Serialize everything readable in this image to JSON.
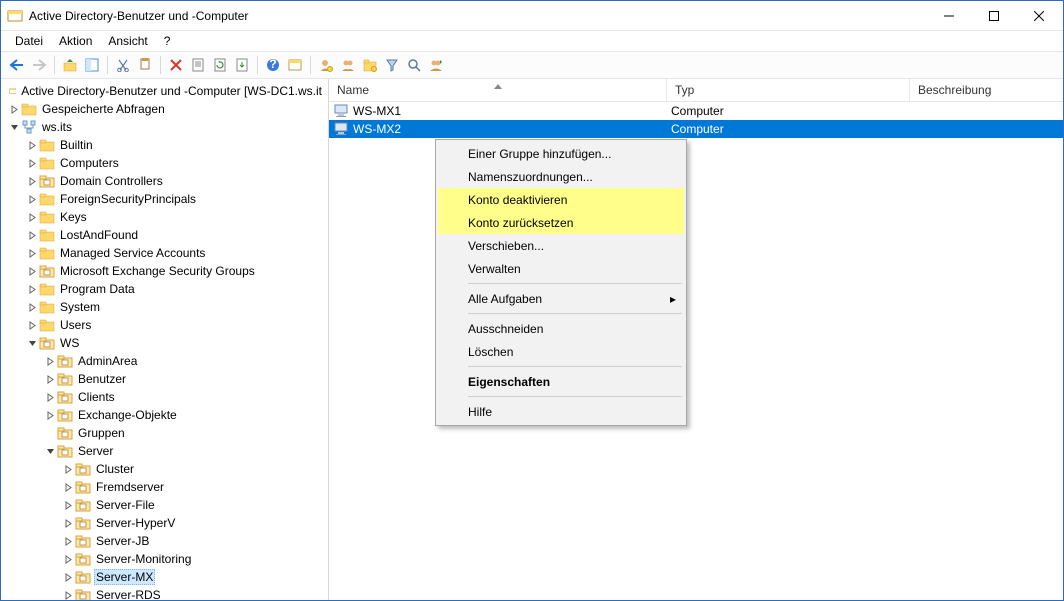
{
  "window": {
    "title": "Active Directory-Benutzer und -Computer"
  },
  "menu": {
    "file": "Datei",
    "action": "Aktion",
    "view": "Ansicht",
    "help": "?"
  },
  "tree": {
    "root": "Active Directory-Benutzer und -Computer [WS-DC1.ws.it",
    "saved_queries": "Gespeicherte Abfragen",
    "domain": "ws.its",
    "builtin": "Builtin",
    "computers": "Computers",
    "domain_controllers": "Domain Controllers",
    "fsp": "ForeignSecurityPrincipals",
    "keys": "Keys",
    "laf": "LostAndFound",
    "msa": "Managed Service Accounts",
    "mesg": "Microsoft Exchange Security Groups",
    "pdata": "Program Data",
    "system": "System",
    "users": "Users",
    "ws": "WS",
    "adminarea": "AdminArea",
    "benutzer": "Benutzer",
    "clients": "Clients",
    "exobj": "Exchange-Objekte",
    "gruppen": "Gruppen",
    "server": "Server",
    "cluster": "Cluster",
    "fremd": "Fremdserver",
    "srvfile": "Server-File",
    "srvhv": "Server-HyperV",
    "srvjb": "Server-JB",
    "srvmon": "Server-Monitoring",
    "srvmx": "Server-MX",
    "srvrds": "Server-RDS"
  },
  "columns": {
    "name": "Name",
    "typ": "Typ",
    "besch": "Beschreibung"
  },
  "rows": [
    {
      "name": "WS-MX1",
      "typ": "Computer",
      "selected": false
    },
    {
      "name": "WS-MX2",
      "typ": "Computer",
      "selected": true
    }
  ],
  "context_menu": {
    "add_to_group": "Einer Gruppe hinzufügen...",
    "name_mappings": "Namenszuordnungen...",
    "disable_account": "Konto deaktivieren",
    "reset_account": "Konto zurücksetzen",
    "move": "Verschieben...",
    "manage": "Verwalten",
    "all_tasks": "Alle Aufgaben",
    "cut": "Ausschneiden",
    "delete": "Löschen",
    "properties": "Eigenschaften",
    "help": "Hilfe"
  }
}
